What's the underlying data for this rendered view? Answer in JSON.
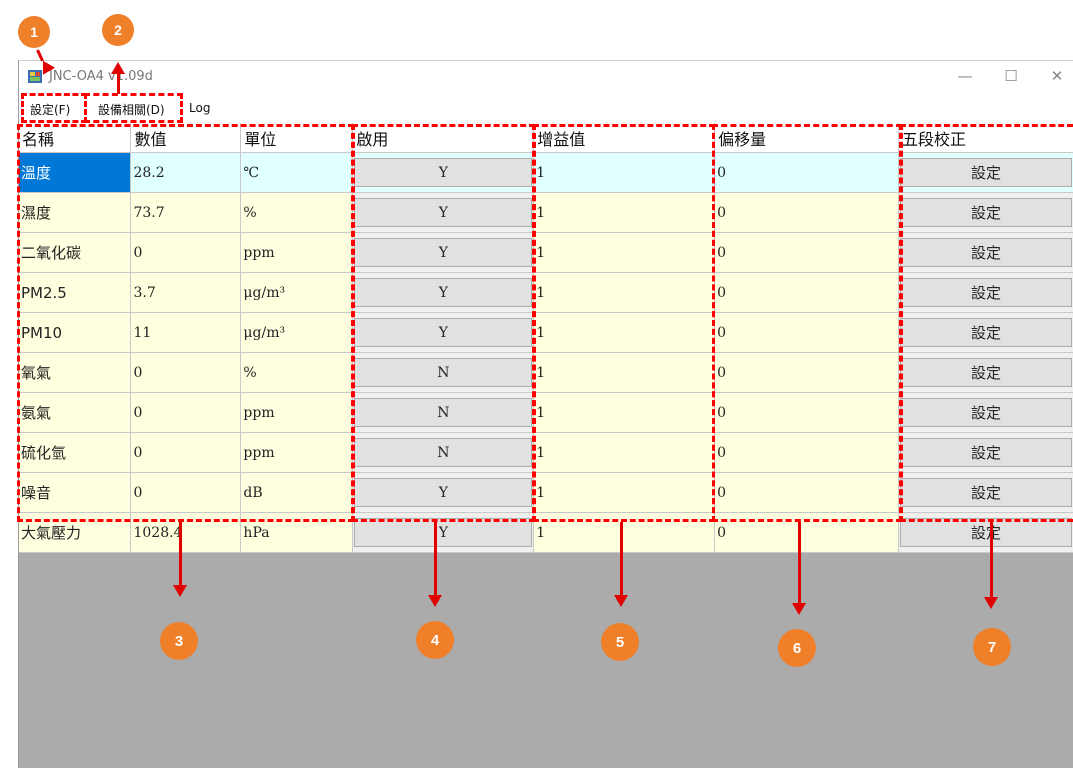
{
  "window": {
    "title": "JNC-OA4  v1.09d",
    "minimize": "—",
    "maximize": "☐",
    "close": "✕"
  },
  "menu": {
    "settings": "設定(F)",
    "device": "設備相關(D)",
    "log": "Log"
  },
  "grid": {
    "headers": {
      "name": "名稱",
      "value": "數值",
      "unit": "單位",
      "enabled": "啟用",
      "gain": "增益值",
      "offset": "偏移量",
      "calibration": "五段校正"
    },
    "rows": [
      {
        "name": "溫度",
        "value": "28.2",
        "unit": "℃",
        "enabled": "Y",
        "gain": "1",
        "offset": "0",
        "calibration": "設定"
      },
      {
        "name": "濕度",
        "value": "73.7",
        "unit": "%",
        "enabled": "Y",
        "gain": "1",
        "offset": "0",
        "calibration": "設定"
      },
      {
        "name": "二氧化碳",
        "value": "0",
        "unit": "ppm",
        "enabled": "Y",
        "gain": "1",
        "offset": "0",
        "calibration": "設定"
      },
      {
        "name": "PM2.5",
        "value": "3.7",
        "unit": "μg/m³",
        "enabled": "Y",
        "gain": "1",
        "offset": "0",
        "calibration": "設定"
      },
      {
        "name": "PM10",
        "value": "11",
        "unit": "μg/m³",
        "enabled": "Y",
        "gain": "1",
        "offset": "0",
        "calibration": "設定"
      },
      {
        "name": "氧氣",
        "value": "0",
        "unit": "%",
        "enabled": "N",
        "gain": "1",
        "offset": "0",
        "calibration": "設定"
      },
      {
        "name": "氨氣",
        "value": "0",
        "unit": "ppm",
        "enabled": "N",
        "gain": "1",
        "offset": "0",
        "calibration": "設定"
      },
      {
        "name": "硫化氫",
        "value": "0",
        "unit": "ppm",
        "enabled": "N",
        "gain": "1",
        "offset": "0",
        "calibration": "設定"
      },
      {
        "name": "噪音",
        "value": "0",
        "unit": "dB",
        "enabled": "Y",
        "gain": "1",
        "offset": "0",
        "calibration": "設定"
      },
      {
        "name": "大氣壓力",
        "value": "1028.4",
        "unit": "hPa",
        "enabled": "Y",
        "gain": "1",
        "offset": "0",
        "calibration": "設定"
      }
    ]
  },
  "annotations": [
    "1",
    "2",
    "3",
    "4",
    "5",
    "6",
    "7"
  ],
  "colors": {
    "annotation_red": "#ff0000",
    "callout_orange": "#f07f2a",
    "selected_blue": "#0078d7",
    "row_yellow": "#ffffe0",
    "active_row_cyan": "#e0ffff"
  },
  "icons": {
    "app": "app-icon"
  }
}
